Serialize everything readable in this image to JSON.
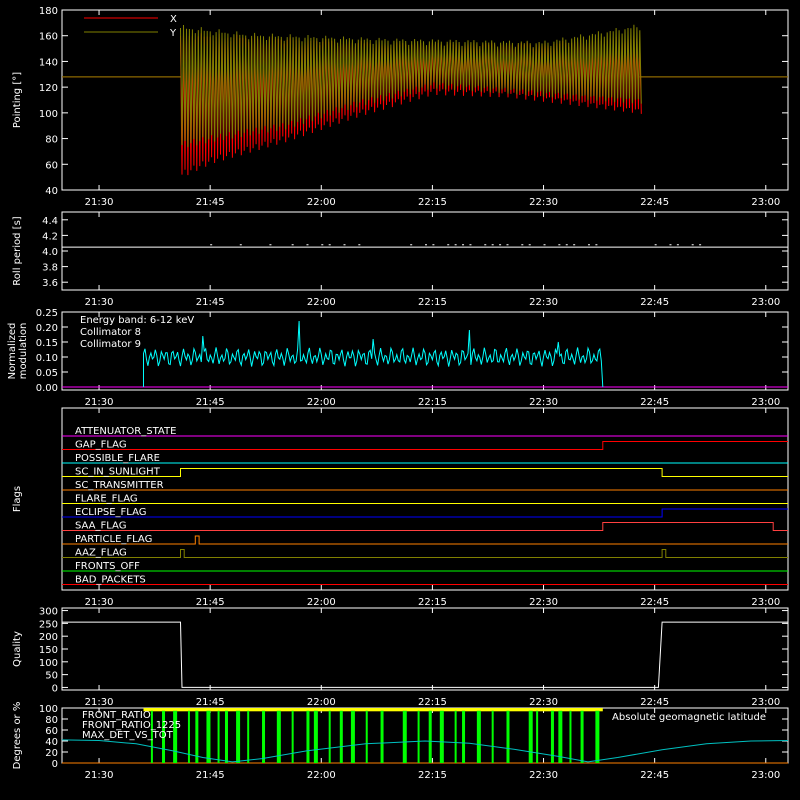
{
  "background": "#000000",
  "axis_color": "#ffffff",
  "time_ticks": [
    "21:30",
    "21:45",
    "22:00",
    "22:15",
    "22:30",
    "22:45",
    "23:00"
  ],
  "time_tick_minutes": [
    0,
    15,
    30,
    45,
    60,
    75,
    90
  ],
  "time_range_minutes": [
    -5,
    93
  ],
  "chart_data": [
    {
      "type": "line",
      "ylabel": "Pointing [°]",
      "ylim": [
        40,
        180
      ],
      "yticks": [
        "40",
        "60",
        "80",
        "100",
        "120",
        "140",
        "160",
        "180"
      ],
      "ytick_values": [
        40,
        60,
        80,
        100,
        120,
        140,
        160,
        180
      ],
      "series": [
        {
          "name": "X",
          "color": "#ff0000",
          "baseline": 128,
          "active_range_min": [
            11,
            73
          ],
          "envelope_top": [
            [
              11,
              160
            ],
            [
              20,
              158
            ],
            [
              40,
              153
            ],
            [
              60,
              153
            ],
            [
              73,
              158
            ]
          ],
          "envelope_bottom": [
            [
              11,
              52
            ],
            [
              15,
              63
            ],
            [
              25,
              80
            ],
            [
              35,
              100
            ],
            [
              45,
              117
            ],
            [
              55,
              115
            ],
            [
              65,
              108
            ],
            [
              73,
              102
            ]
          ]
        },
        {
          "name": "Y",
          "color": "#808000",
          "baseline": 128,
          "active_range_min": [
            11,
            73
          ],
          "envelope_top": [
            [
              11,
              166
            ],
            [
              20,
              160
            ],
            [
              40,
              156
            ],
            [
              60,
              154
            ],
            [
              73,
              167
            ]
          ],
          "envelope_bottom": [
            [
              11,
              75
            ],
            [
              15,
              80
            ],
            [
              25,
              90
            ],
            [
              35,
              108
            ],
            [
              45,
              122
            ],
            [
              55,
              118
            ],
            [
              65,
              113
            ],
            [
              73,
              110
            ]
          ]
        }
      ]
    },
    {
      "type": "line",
      "ylabel": "Roll period [s]",
      "ylim": [
        3.5,
        4.5
      ],
      "yticks": [
        "3.6",
        "3.8",
        "4.0",
        "4.2",
        "4.4"
      ],
      "ytick_values": [
        3.6,
        3.8,
        4.0,
        4.2,
        4.4
      ],
      "series": [
        {
          "name": "",
          "color": "#ffffff",
          "baseline": 4.05,
          "bump_times_min": [
            15,
            19,
            23,
            26,
            28,
            30,
            31,
            33,
            35,
            42,
            44,
            45,
            47,
            48,
            49,
            50,
            52,
            53,
            54,
            55,
            57,
            58,
            60,
            62,
            63,
            64,
            66,
            67,
            75,
            77,
            78,
            80,
            81
          ],
          "bump_value": 4.08
        }
      ]
    },
    {
      "type": "line",
      "ylabel": "Normalized modulation",
      "ylim": [
        -0.01,
        0.25
      ],
      "yticks": [
        "0.00",
        "0.05",
        "0.10",
        "0.15",
        "0.20",
        "0.25"
      ],
      "ytick_values": [
        0.0,
        0.05,
        0.1,
        0.15,
        0.2,
        0.25
      ],
      "legend": [
        "Energy band: 6-12 keV",
        "Collimator 8",
        "Collimator 9"
      ],
      "series": [
        {
          "name": "Collimator 8",
          "color": "#00ffff",
          "active_range_min": [
            6,
            68
          ],
          "mean": 0.1,
          "spike": [
            [
              14,
              0.17
            ],
            [
              27,
              0.22
            ],
            [
              37,
              0.16
            ],
            [
              50,
              0.19
            ],
            [
              62,
              0.15
            ]
          ]
        },
        {
          "name": "Collimator 9",
          "color": "#ff00ff",
          "value": 0.0
        }
      ]
    },
    {
      "type": "line",
      "ylabel": "Flags",
      "flags": [
        {
          "label": "ATTENUATOR_STATE",
          "color": "#ff00ff",
          "steps": []
        },
        {
          "label": "GAP_FLAG",
          "color": "#ff0000",
          "steps": [
            [
              68,
              1
            ]
          ]
        },
        {
          "label": "POSSIBLE_FLARE",
          "color": "#00ffff",
          "steps": []
        },
        {
          "label": "SC_IN_SUNLIGHT",
          "color": "#ffff00",
          "steps": [
            [
              11,
              1
            ],
            [
              76,
              0
            ]
          ]
        },
        {
          "label": "SC_TRANSMITTER",
          "color": "#ff8000",
          "steps": []
        },
        {
          "label": "FLARE_FLAG",
          "color": "#ffff00",
          "steps": []
        },
        {
          "label": "ECLIPSE_FLAG",
          "color": "#0000ff",
          "steps": [
            [
              11,
              0
            ],
            [
              76,
              1
            ]
          ]
        },
        {
          "label": "SAA_FLAG",
          "color": "#ff4040",
          "steps": [
            [
              68,
              1
            ],
            [
              91,
              0
            ]
          ]
        },
        {
          "label": "PARTICLE_FLAG",
          "color": "#ff8000",
          "steps": [
            [
              6,
              0
            ],
            [
              13,
              1
            ],
            [
              13.5,
              0
            ]
          ]
        },
        {
          "label": "AAZ_FLAG",
          "color": "#808000",
          "steps": [
            [
              11,
              1
            ],
            [
              11.5,
              0
            ],
            [
              76,
              1
            ],
            [
              76.5,
              0
            ]
          ]
        },
        {
          "label": "FRONTS_OFF",
          "color": "#00ff00",
          "steps": []
        },
        {
          "label": "BAD_PACKETS",
          "color": "#ff0000",
          "steps": []
        }
      ]
    },
    {
      "type": "line",
      "ylabel": "Quality",
      "ylim": [
        -10,
        310
      ],
      "yticks": [
        "0",
        "50",
        "100",
        "150",
        "200",
        "250",
        "300"
      ],
      "ytick_values": [
        0,
        50,
        100,
        150,
        200,
        250,
        300
      ],
      "series": [
        {
          "name": "",
          "color": "#ffffff",
          "steps": [
            [
              -5,
              255
            ],
            [
              11,
              255
            ],
            [
              11.2,
              0
            ],
            [
              75.5,
              0
            ],
            [
              76,
              255
            ],
            [
              93,
              255
            ]
          ]
        }
      ]
    },
    {
      "type": "line",
      "ylabel": "Degrees or %",
      "ylim": [
        0,
        100
      ],
      "yticks": [
        "0",
        "20",
        "40",
        "60",
        "80",
        "100"
      ],
      "ytick_values": [
        0,
        20,
        40,
        60,
        80,
        100
      ],
      "legend_right": "Absolute geomagnetic latitude",
      "series": [
        {
          "name": "FRONT_RATIO",
          "color": "#ffff00",
          "active_range_min": [
            6,
            68
          ],
          "value": 97
        },
        {
          "name": "FRONT_RATIO_1225",
          "color": "#00ff00",
          "active_range_min": [
            6,
            68
          ],
          "drops_min": [
            7,
            8.5,
            10,
            12,
            13,
            14.5,
            16,
            17,
            18.5,
            20,
            22,
            24,
            26,
            28,
            29,
            31,
            32.5,
            34,
            36,
            38,
            41,
            43,
            44.5,
            46,
            48,
            49,
            51,
            53,
            55,
            58,
            59,
            61,
            62,
            63.5,
            65,
            67
          ]
        },
        {
          "name": "MAX_DET_VS_TOT",
          "color": "#ff8000",
          "value": 0
        },
        {
          "name": "Absolute geomagnetic latitude",
          "color": "#00c0c0",
          "points": [
            [
              -5,
              42
            ],
            [
              0,
              41
            ],
            [
              5,
              35
            ],
            [
              10,
              22
            ],
            [
              14,
              10
            ],
            [
              18,
              2
            ],
            [
              22,
              8
            ],
            [
              28,
              22
            ],
            [
              36,
              35
            ],
            [
              44,
              40
            ],
            [
              50,
              36
            ],
            [
              56,
              25
            ],
            [
              62,
              12
            ],
            [
              66,
              2
            ],
            [
              70,
              10
            ],
            [
              76,
              24
            ],
            [
              82,
              35
            ],
            [
              88,
              40
            ],
            [
              93,
              41
            ]
          ]
        }
      ]
    }
  ]
}
